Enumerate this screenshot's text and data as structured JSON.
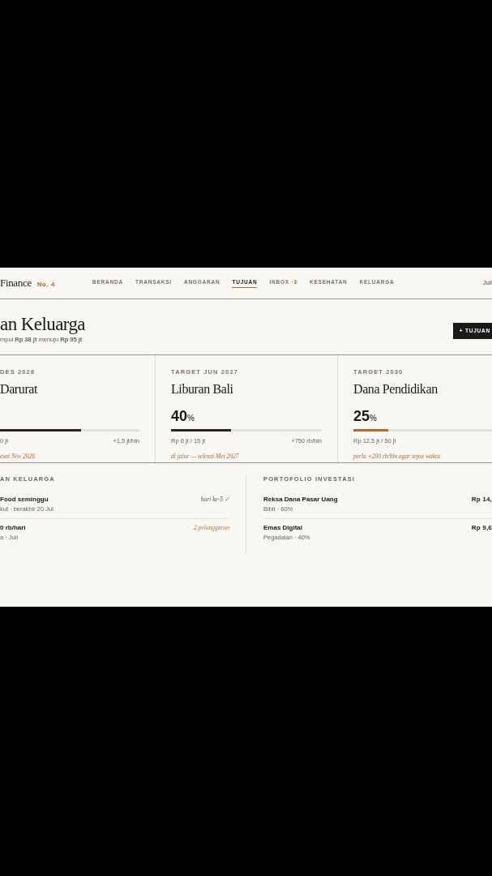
{
  "brand": {
    "name": "Finance",
    "issue": "No. 4"
  },
  "nav": [
    {
      "label": "BERANDA",
      "selected": false
    },
    {
      "label": "TRANSAKSI",
      "selected": false
    },
    {
      "label": "ANGGARAN",
      "selected": false
    },
    {
      "label": "TUJUAN",
      "selected": true
    },
    {
      "label": "INBOX",
      "badge": "·3",
      "selected": false
    },
    {
      "label": "KESEHATAN",
      "selected": false
    },
    {
      "label": "KELUARGA",
      "selected": false
    }
  ],
  "date": "Juli",
  "header": {
    "title": "an Keluarga",
    "subtitle": "mpul **Rp 38 jt** menuju **Rp 95 jt**",
    "button": "+ TUJUAN"
  },
  "goals": [
    {
      "target": "DES 2026",
      "name": "Darurat",
      "level": 0.58,
      "color": "#2a2724",
      "amount": "0 jt",
      "rate": "+1,5 jt/bln",
      "note": "esai Nov 2026"
    },
    {
      "target": "TARGET JUN 2027",
      "name": "Liburan Bali",
      "percent": "40",
      "unit": "%",
      "level": 0.4,
      "color": "#2a2724",
      "amount": "Rp 6 jt / 15 jt",
      "rate": "+750 rb/bln",
      "note": "di jalur — selesai Mei 2027"
    },
    {
      "target": "TARGET 2030",
      "name": "Dana Pendidikan",
      "percent": "25",
      "unit": "%",
      "level": 0.25,
      "color": "#b06a32",
      "amount": "Rp 12,5 jt / 50 jt",
      "note": "perlu +200 rb/bln agar tepat waktu"
    }
  ],
  "challenges": {
    "heading": "AN KELUARGA",
    "rows": [
      {
        "title": "Food seminggu",
        "sub": "kut · berakhir 20 Jul",
        "status": "hari ke-5 ✓",
        "kind": "ok"
      },
      {
        "title": "0 rb/hari",
        "sub": "a · Juli",
        "status": "2 pelanggaran",
        "kind": "warn"
      }
    ]
  },
  "portfolio": {
    "heading": "PORTOFOLIO INVESTASI",
    "rows": [
      {
        "title": "Reksa Dana Pasar Uang",
        "sub": "Bibit · 60%",
        "value": "Rp 14,"
      },
      {
        "title": "Emas Digital",
        "sub": "Pegadaian · 40%",
        "value": "Rp 9,6"
      }
    ]
  }
}
